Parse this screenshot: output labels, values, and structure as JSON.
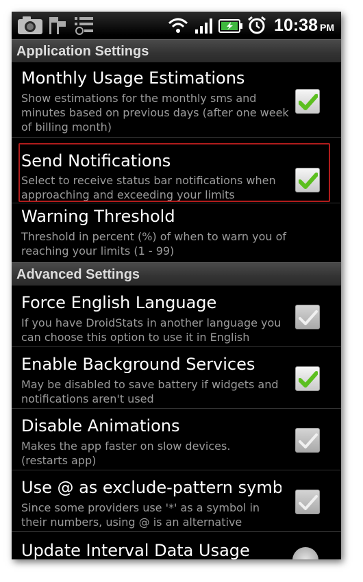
{
  "status_bar": {
    "icons": [
      "camera-icon",
      "settings-flags-icon",
      "list-icon",
      "wifi-icon",
      "signal-icon",
      "battery-charging-icon",
      "alarm-clock-icon"
    ],
    "time": "10:38",
    "ampm": "PM"
  },
  "sections": [
    {
      "header": "Application Settings",
      "items": [
        {
          "title": "Monthly Usage Estimations",
          "summary": "Show estimations for the monthly sms and minutes based on previous days (after one week of billing month)",
          "checked": true
        },
        {
          "title": "Send Notifications",
          "summary": "Select to receive status bar notifications when approaching and exceeding your limits",
          "checked": true
        },
        {
          "title": "Warning Threshold",
          "summary": "Threshold in percent (%) of when to warn you of reaching your limits (1 - 99)",
          "checked": null
        }
      ]
    },
    {
      "header": "Advanced Settings",
      "items": [
        {
          "title": "Force English Language",
          "summary": "If you have DroidStats in another language you can choose this option to use it in English",
          "checked": false
        },
        {
          "title": "Enable Background Services",
          "summary": "May be disabled to save battery if widgets and notifications aren't used",
          "checked": true
        },
        {
          "title": "Disable Animations",
          "summary": "Makes the app faster on slow devices. (restarts app)",
          "checked": false
        },
        {
          "title": "Use @ as exclude-pattern symbol",
          "summary": "Since some providers use '*' as a symbol in their numbers, using @ is an alternative",
          "checked": false
        },
        {
          "title": "Update Interval Data Usage",
          "summary": "",
          "checked": null
        }
      ]
    }
  ],
  "colors": {
    "check_green": "#5cbf1f",
    "focus_border": "#b11c1c",
    "header_bg": "#3a3a3a"
  }
}
